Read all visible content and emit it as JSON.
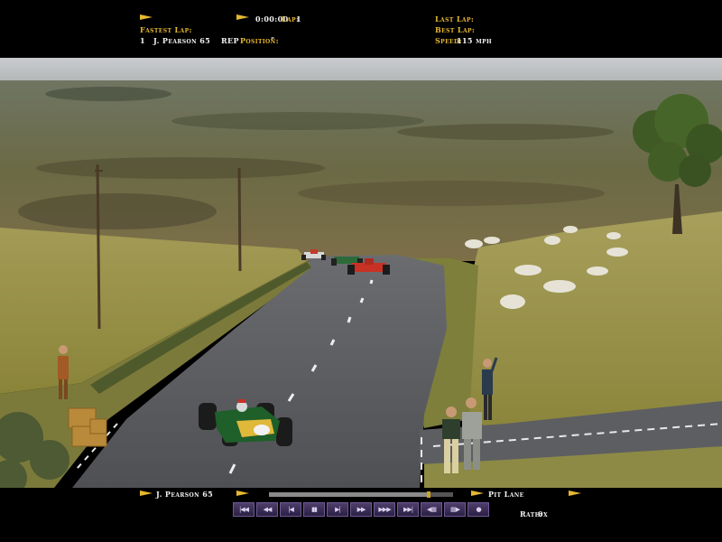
{
  "top_hud": {
    "fastest_lap_label": "Fastest Lap:",
    "fastest_lap_number": "1",
    "fastest_lap_driver": "J. Pearson 65",
    "rep_label": "REP",
    "position_label": "Position:",
    "position_value": "\"",
    "time_value": "0:00:00",
    "lap_label": "Lap:",
    "lap_value": "1",
    "last_lap_label": "Last Lap:",
    "best_lap_label": "Best Lap:",
    "speed_label": "Speed:",
    "speed_value": "115 mph"
  },
  "bottom_hud": {
    "driver_name": "J. Pearson 65",
    "camera_label": "Pit Lane",
    "rate_label": "Rate:",
    "rate_value": "0x",
    "replay_progress": 0.87,
    "controls": [
      {
        "id": "jump-start",
        "glyph": "|◀◀"
      },
      {
        "id": "rewind",
        "glyph": "◀◀"
      },
      {
        "id": "step-back",
        "glyph": "|◀"
      },
      {
        "id": "pause",
        "glyph": "▮▮"
      },
      {
        "id": "step-forward",
        "glyph": "▶|"
      },
      {
        "id": "play",
        "glyph": "▶▶"
      },
      {
        "id": "fast-forward",
        "glyph": "▶▶▶"
      },
      {
        "id": "jump-end",
        "glyph": "▶▶|"
      },
      {
        "id": "previous-camera",
        "glyph": "◀▦"
      },
      {
        "id": "next-camera",
        "glyph": "▦▶"
      },
      {
        "id": "record",
        "glyph": "●"
      }
    ]
  },
  "colors": {
    "hud_gold": "#e6b830",
    "hud_white": "#f2f2f2",
    "grass": "#8f8a3c",
    "asphalt": "#595a5e",
    "player_car": "#1f5f2a"
  },
  "icons": [
    "pennant-flag-icon"
  ]
}
